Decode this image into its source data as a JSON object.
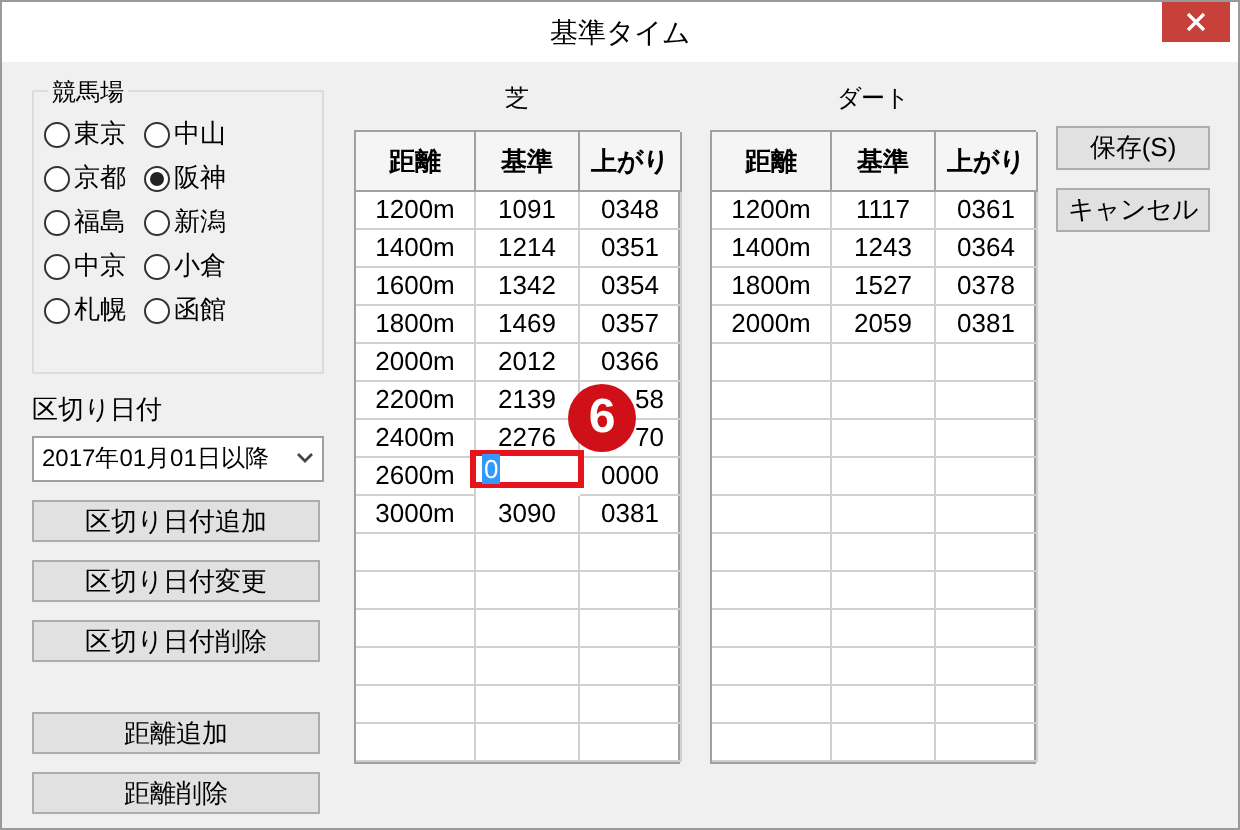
{
  "window": {
    "title": "基準タイム"
  },
  "racecourse": {
    "label": "競馬場",
    "options": [
      {
        "label": "東京",
        "selected": false
      },
      {
        "label": "中山",
        "selected": false
      },
      {
        "label": "京都",
        "selected": false
      },
      {
        "label": "阪神",
        "selected": true
      },
      {
        "label": "福島",
        "selected": false
      },
      {
        "label": "新潟",
        "selected": false
      },
      {
        "label": "中京",
        "selected": false
      },
      {
        "label": "小倉",
        "selected": false
      },
      {
        "label": "札幌",
        "selected": false
      },
      {
        "label": "函館",
        "selected": false
      }
    ]
  },
  "cutoff_date": {
    "label": "区切り日付",
    "value": "2017年01月01日以降"
  },
  "date_buttons": [
    "区切り日付追加",
    "区切り日付変更",
    "区切り日付削除"
  ],
  "distance_buttons": [
    "距離追加",
    "距離削除"
  ],
  "turf": {
    "title": "芝",
    "columns": [
      "距離",
      "基準",
      "上がり"
    ],
    "rows": [
      [
        "1200m",
        "1091",
        "0348"
      ],
      [
        "1400m",
        "1214",
        "0351"
      ],
      [
        "1600m",
        "1342",
        "0354"
      ],
      [
        "1800m",
        "1469",
        "0357"
      ],
      [
        "2000m",
        "2012",
        "0366"
      ],
      [
        "2200m",
        "2139",
        "58"
      ],
      [
        "2400m",
        "2276",
        "70"
      ],
      [
        "2600m",
        {
          "text": "0",
          "editing": true
        },
        "0000"
      ],
      [
        "3000m",
        "3090",
        "0381"
      ]
    ],
    "callout": {
      "badge": "6"
    }
  },
  "dirt": {
    "title": "ダート",
    "columns": [
      "距離",
      "基準",
      "上がり"
    ],
    "rows": [
      [
        "1200m",
        "1117",
        "0361"
      ],
      [
        "1400m",
        "1243",
        "0364"
      ],
      [
        "1800m",
        "1527",
        "0378"
      ],
      [
        "2000m",
        "2059",
        "0381"
      ]
    ]
  },
  "actions": [
    {
      "label": "保存(S)"
    },
    {
      "label": "キャンセル"
    }
  ]
}
